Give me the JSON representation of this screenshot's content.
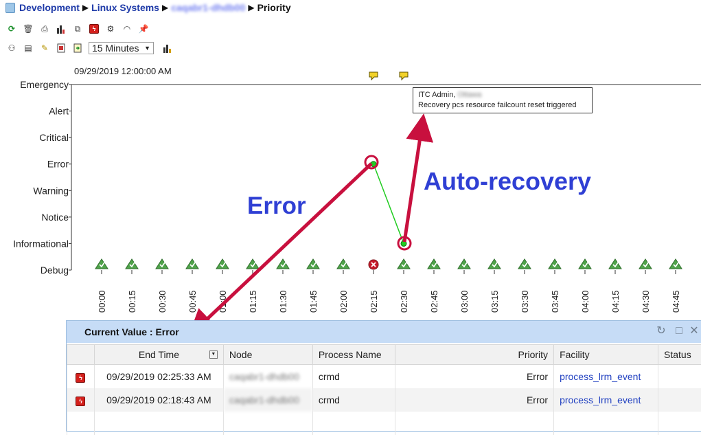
{
  "breadcrumb": [
    {
      "label": "Development"
    },
    {
      "label": "Linux Systems"
    },
    {
      "label": "caqabr1-dhdb00"
    },
    {
      "label": "Priority"
    }
  ],
  "toolbar1": {
    "icons": [
      "refresh-icon",
      "delete-icon",
      "printer-icon",
      "bar-chart-icon",
      "network-icon",
      "alert-icon",
      "settings-icon",
      "signal-icon",
      "pin-icon"
    ]
  },
  "toolbar2": {
    "icons": [
      "group-icon",
      "document-icon",
      "edit-icon",
      "report-icon",
      "export-icon"
    ],
    "interval": "15 Minutes",
    "chart_icon": "bar-chart-icon"
  },
  "chart_data": {
    "type": "line",
    "start_label": "09/29/2019 12:00:00 AM",
    "y_categories": [
      "Emergency",
      "Alert",
      "Critical",
      "Error",
      "Warning",
      "Notice",
      "Informational",
      "Debug"
    ],
    "x": [
      "00:00",
      "00:15",
      "00:30",
      "00:45",
      "01:00",
      "01:15",
      "01:30",
      "01:45",
      "02:00",
      "02:15",
      "02:30",
      "02:45",
      "03:00",
      "03:15",
      "03:30",
      "03:45",
      "04:00",
      "04:15",
      "04:30",
      "04:45"
    ],
    "series": [
      {
        "points": [
          {
            "x": "02:15",
            "y": "Error"
          },
          {
            "x": "02:30",
            "y": "Informational"
          }
        ],
        "color": "#22cc22"
      }
    ],
    "status_markers": [
      "ok",
      "ok",
      "ok",
      "ok",
      "ok",
      "ok",
      "ok",
      "ok",
      "ok",
      "error",
      "ok",
      "ok",
      "ok",
      "ok",
      "ok",
      "ok",
      "ok",
      "ok",
      "ok",
      "ok"
    ],
    "notes": [
      {
        "x": "02:15"
      },
      {
        "x": "02:30"
      }
    ],
    "tooltip": {
      "line1": "ITC Admin, ",
      "line1_blurred": "Ottawa",
      "line2": "Recovery pcs resource failcount reset triggered"
    }
  },
  "annotations": {
    "error_label": "Error",
    "recovery_label": "Auto-recovery"
  },
  "panel": {
    "title": "Current Value : Error",
    "columns": [
      "End Time",
      "Node",
      "Process Name",
      "Priority",
      "Facility",
      "Status"
    ],
    "rows": [
      {
        "end_time": "09/29/2019 02:25:33 AM",
        "node": "caqabr1-dhdb00",
        "process": "crmd",
        "priority": "Error",
        "facility": "process_lrm_event",
        "status": ""
      },
      {
        "end_time": "09/29/2019 02:18:43 AM",
        "node": "caqabr1-dhdb00",
        "process": "crmd",
        "priority": "Error",
        "facility": "process_lrm_event",
        "status": ""
      }
    ]
  },
  "colors": {
    "accent_arrow": "#c8103e",
    "annotation_text": "#2f3fd4",
    "series_line": "#22cc22",
    "panel_header": "#c6dcf6"
  }
}
